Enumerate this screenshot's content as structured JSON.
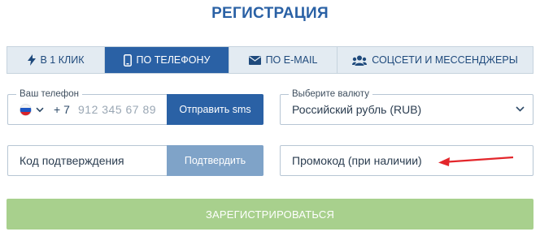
{
  "title": "РЕГИСТРАЦИЯ",
  "tabs": [
    {
      "label": "В 1 КЛИК",
      "icon": "lightning-icon"
    },
    {
      "label": "ПО ТЕЛЕФОНУ",
      "icon": "phone-icon"
    },
    {
      "label": "ПО E-MAIL",
      "icon": "envelope-icon"
    },
    {
      "label": "СОЦСЕТИ И МЕССЕНДЖЕРЫ",
      "icon": "users-icon"
    }
  ],
  "phone": {
    "legend": "Ваш телефон",
    "country_code": "+ 7",
    "placeholder": "912 345 67 89",
    "send_sms_label": "Отправить sms"
  },
  "currency": {
    "legend": "Выберите валюту",
    "value": "Российский рубль (RUB)"
  },
  "code": {
    "placeholder": "Код подтверждения",
    "confirm_label": "Подтвердить"
  },
  "promo": {
    "placeholder": "Промокод (при наличии)"
  },
  "register_label": "ЗАРЕГИСТРИРОВАТЬСЯ",
  "colors": {
    "accent": "#2a61a5",
    "confirm_disabled": "#7fa3c8",
    "register": "#a8d08d",
    "arrow": "#e3262b"
  }
}
